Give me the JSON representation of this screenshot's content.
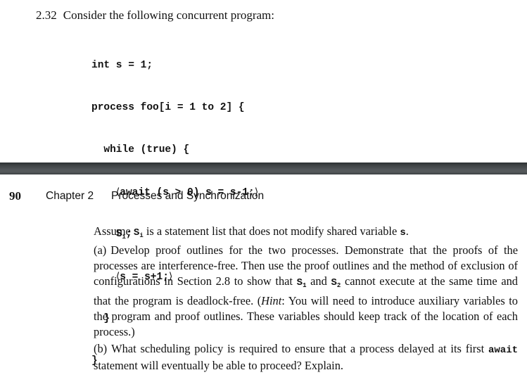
{
  "exercise": {
    "number": "2.32",
    "prompt": "Consider the following concurrent program:"
  },
  "code": {
    "line1": {
      "kw": "int",
      "rest": " s = 1;"
    },
    "line2": {
      "kw": "process",
      "rest": " foo[i = 1 to 2] {"
    },
    "line3": {
      "indent": "  ",
      "kw": "while",
      "rest": " (true) {"
    },
    "line4": {
      "indent": "    ",
      "open": "⟨",
      "text": "await (s > 0) s = s-1;",
      "close": "⟩"
    },
    "line5": {
      "indent": "    ",
      "stmt": "S",
      "sub": "i",
      "rest": ";"
    },
    "line6": {
      "indent": "    ",
      "open": "⟨",
      "text": "s = s+1;",
      "close": "⟩"
    },
    "line7": {
      "indent": "  ",
      "text": "}"
    },
    "line8": {
      "text": "}"
    }
  },
  "running_head": {
    "page_number": "90",
    "chapter": "Chapter 2",
    "title": "Processes and Synchronization"
  },
  "body": {
    "assume": {
      "pre": "Assume ",
      "var": "S",
      "var_sub": "i",
      "mid": " is a statement list that does not modify shared variable ",
      "shared": "s",
      "end": "."
    },
    "part_a": {
      "label": "(a)",
      "t1": "Develop proof outlines for the two processes. Demonstrate that the proofs of the processes are interference-free. Then use the proof outlines and the method of exclusion of configurations in Section 2.8 to show that ",
      "v1": "S",
      "v1_sub": "1",
      "t2": " and ",
      "v2": "S",
      "v2_sub": "2",
      "t3": " cannot execute at the same time and that the program is deadlock-free. (",
      "hint": "Hint",
      "t4": ": You will need to introduce auxiliary variables to the program and proof outlines. These variables should keep track of the location of each process.)"
    },
    "part_b": {
      "label": "(b)",
      "t1": "What scheduling policy is required to ensure that a process delayed at its first ",
      "kw": "await",
      "t2": " statement will eventually be able to proceed? Explain."
    }
  }
}
